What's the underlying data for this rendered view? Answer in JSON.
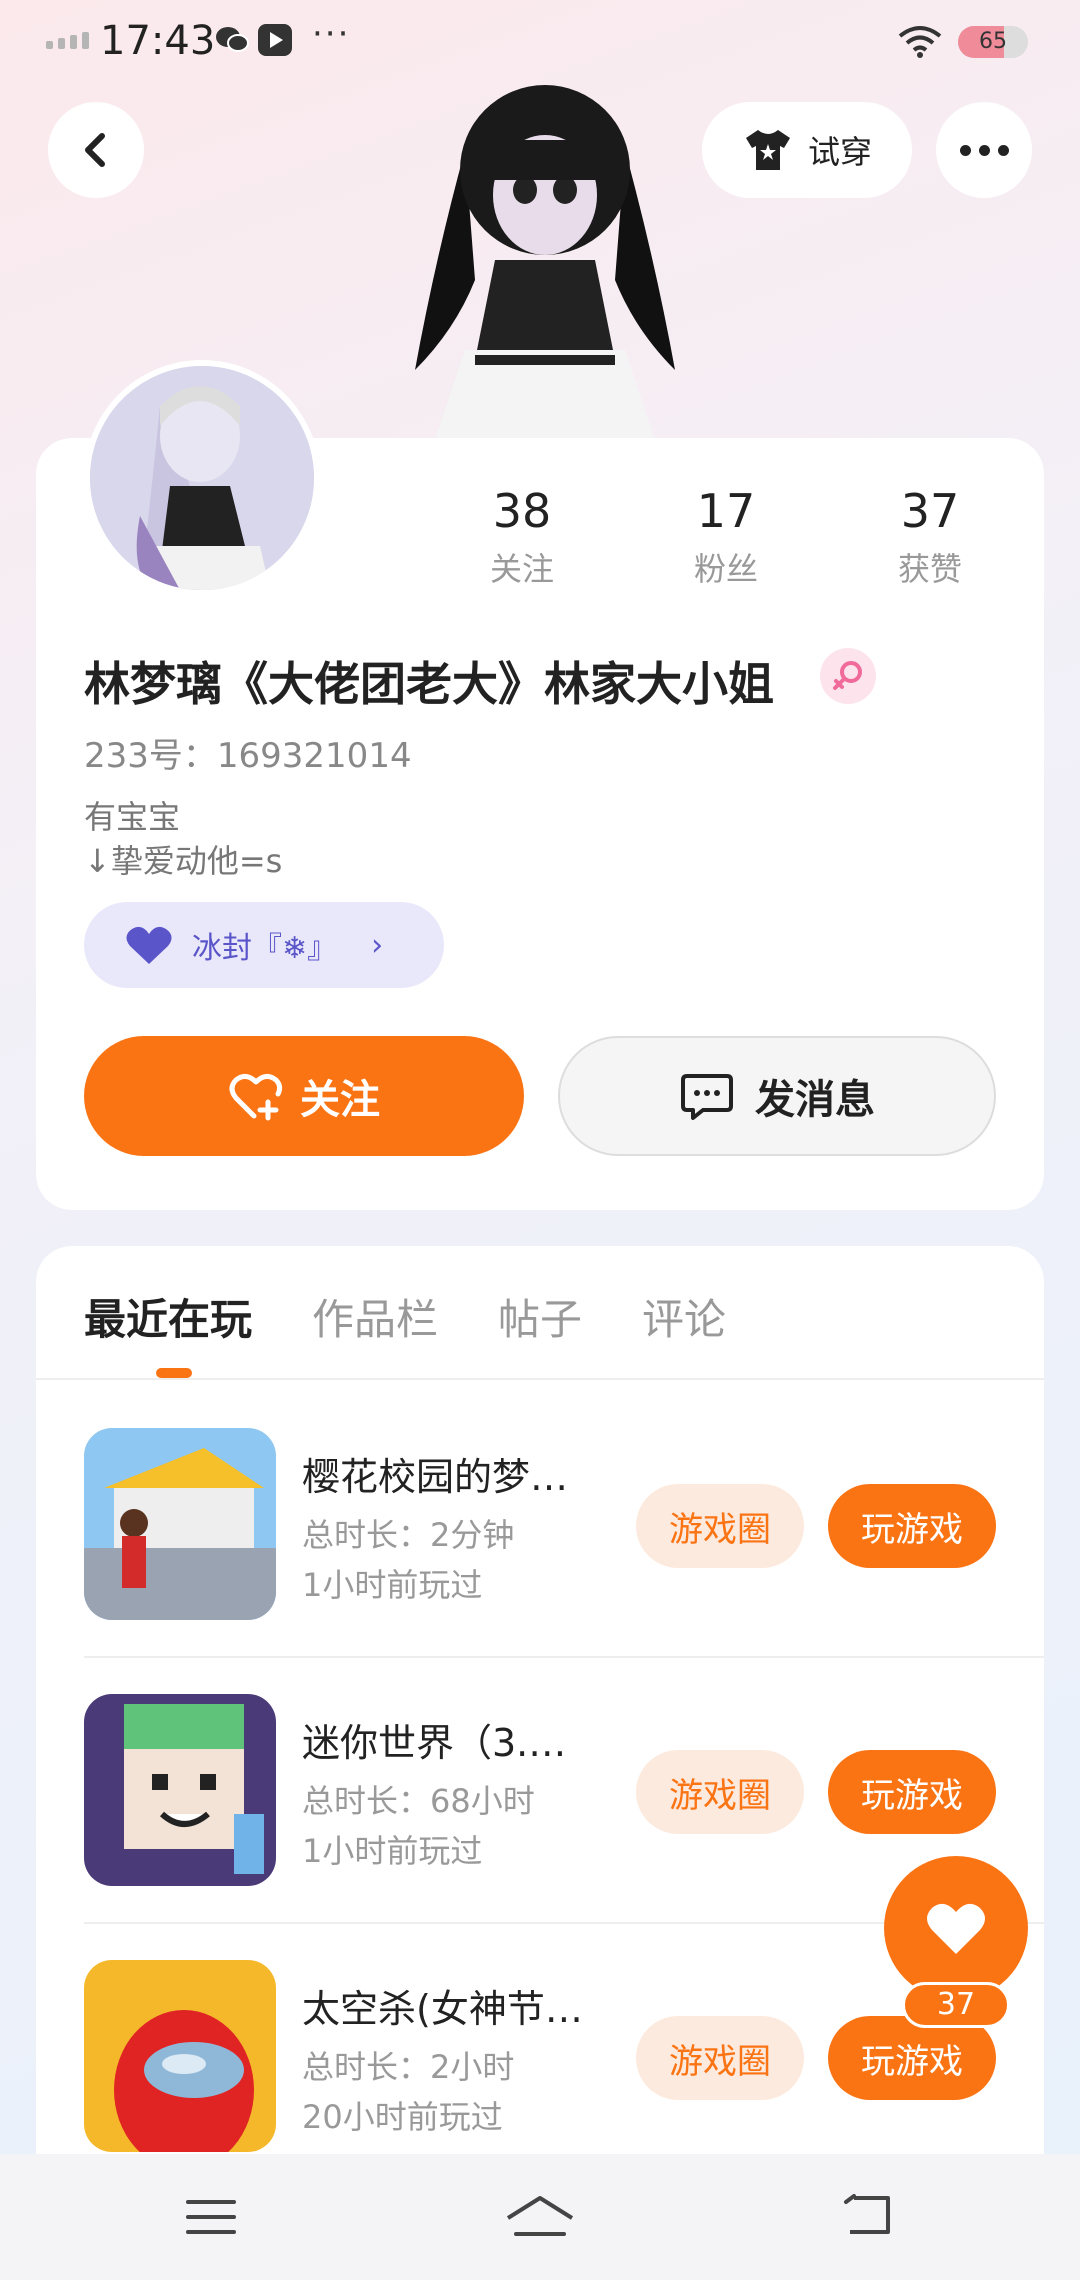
{
  "status_bar": {
    "time": "17:43",
    "more": "···",
    "battery": "65",
    "battery_level": 0.65,
    "icons": [
      "signal-icon",
      "wechat-icon",
      "video-app-icon",
      "wifi-icon",
      "battery-icon"
    ]
  },
  "header": {
    "tryon_label": "试穿",
    "icons": [
      "back-icon",
      "shirt-icon",
      "more-icon"
    ]
  },
  "profile": {
    "stats": [
      {
        "num": "38",
        "label": "关注"
      },
      {
        "num": "17",
        "label": "粉丝"
      },
      {
        "num": "37",
        "label": "获赞"
      }
    ],
    "name": "林梦璃《大佬团老大》林家大小姐",
    "id_line": "233号：169321014",
    "bio_line1": "有宝宝",
    "bio_line2": "↓挚爱动他=s",
    "badge_label": "冰封『❄』",
    "follow_label": "关注",
    "message_label": "发消息"
  },
  "tabs": [
    "最近在玩",
    "作品栏",
    "帖子",
    "评论"
  ],
  "games": [
    {
      "name": "樱花校园的梦…",
      "duration": "总时长：2分钟",
      "last_played": "1小时前玩过",
      "circle_label": "游戏圈",
      "play_label": "玩游戏"
    },
    {
      "name": "迷你世界（3.…",
      "duration": "总时长：68小时",
      "last_played": "1小时前玩过",
      "circle_label": "游戏圈",
      "play_label": "玩游戏"
    },
    {
      "name": "太空杀(女神节…",
      "duration": "总时长：2小时",
      "last_played": "20小时前玩过",
      "circle_label": "游戏圈",
      "play_label": "玩游戏"
    }
  ],
  "like": {
    "count": "37"
  },
  "colors": {
    "accent": "#fb7414",
    "accent_light": "#fdeadf",
    "badge_bg": "#e9e8fb",
    "badge_text": "#5a55c8"
  }
}
